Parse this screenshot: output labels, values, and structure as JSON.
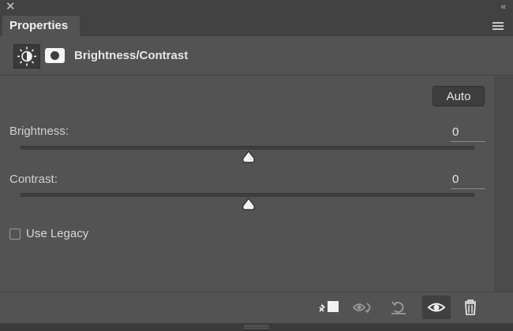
{
  "window": {
    "close_icon": "close-icon",
    "collapse_icon": "double-chevron-left-icon"
  },
  "tab": {
    "label": "Properties",
    "menu_icon": "panel-menu-icon"
  },
  "header": {
    "title": "Brightness/Contrast",
    "adjustment_icon": "brightness-contrast-icon",
    "mask_icon": "layer-mask-icon"
  },
  "controls": {
    "auto_label": "Auto",
    "brightness": {
      "label": "Brightness:",
      "value": "0",
      "fraction": 0.5
    },
    "contrast": {
      "label": "Contrast:",
      "value": "0",
      "fraction": 0.5
    },
    "use_legacy": {
      "label": "Use Legacy",
      "checked": false
    }
  },
  "footer": {
    "icons": [
      "clip-to-layer-icon",
      "view-previous-state-icon",
      "reset-icon",
      "visibility-eye-icon",
      "trash-icon"
    ]
  },
  "colors": {
    "panel": "#535353",
    "bar": "#424242",
    "text": "#e6e6e6"
  }
}
